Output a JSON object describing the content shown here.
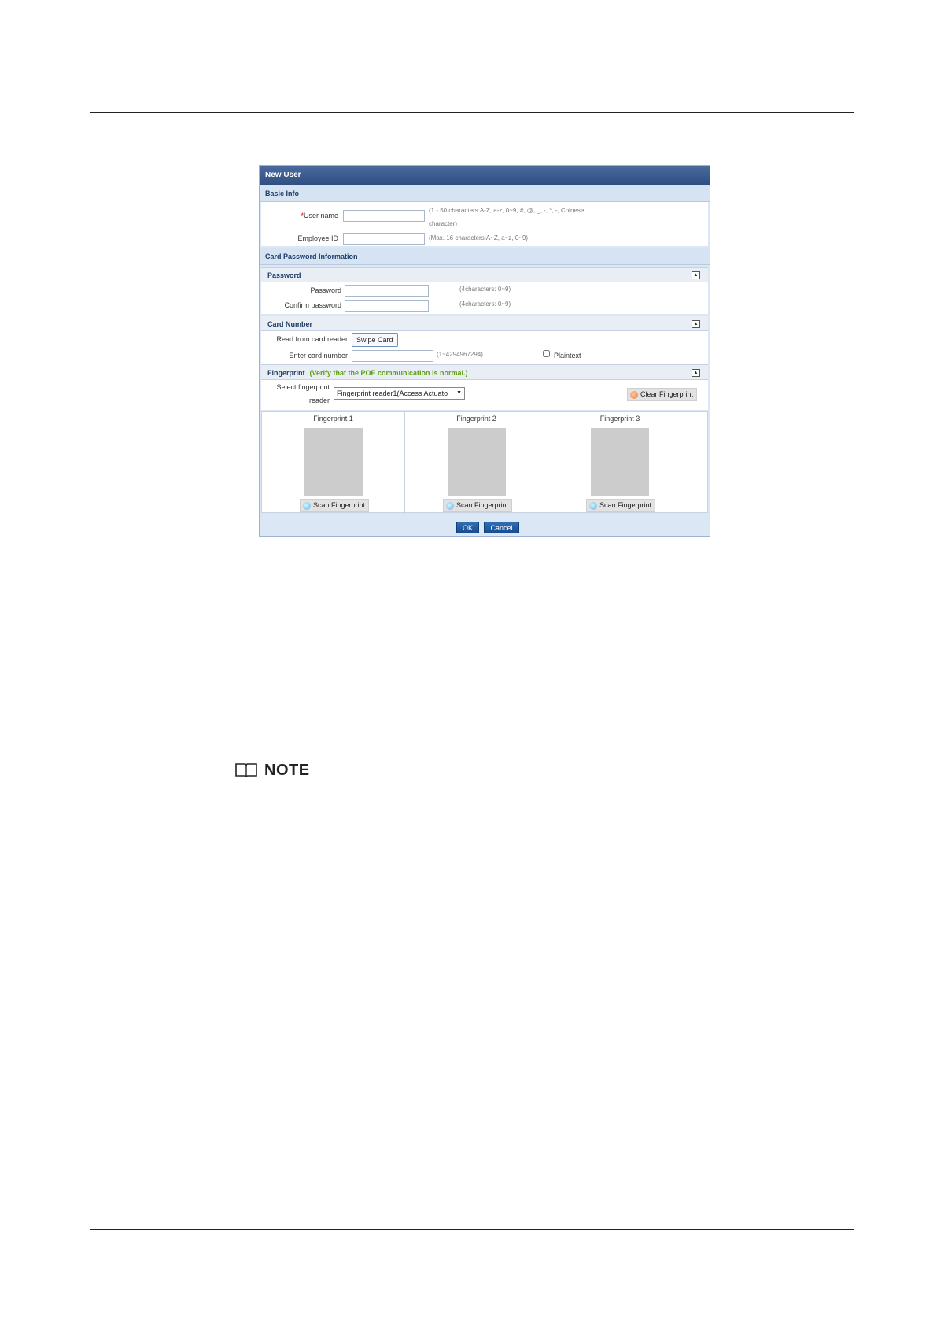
{
  "dialog": {
    "title": "New User",
    "basic_info": {
      "heading": "Basic Info",
      "user_name_required_mark": "*",
      "user_name_label": "User name",
      "user_name_hint_line1": "(1 - 50 characters:A-Z, a-z, 0~9, #, @, _, -, *, -, Chinese",
      "user_name_hint_line2": "character)",
      "user_name_value": "",
      "employee_id_label": "Employee ID",
      "employee_id_hint": "(Max. 16 characters:A~Z, a~z, 0~9)",
      "employee_id_value": ""
    },
    "card_password": {
      "heading": "Card Password Information",
      "password_section": {
        "heading": "Password",
        "password_label": "Password",
        "password_hint": "(4characters: 0~9)",
        "confirm_label": "Confirm password",
        "confirm_hint": "(4characters: 0~9)"
      },
      "card_section": {
        "heading": "Card Number",
        "read_label": "Read from card reader",
        "swipe_button": "Swipe Card",
        "enter_label": "Enter card number",
        "enter_hint": "(1~4294967294)",
        "plaintext_label": "Plaintext",
        "plaintext_checked": false
      },
      "fingerprint_section": {
        "heading": "Fingerprint",
        "warning": "(Verify that the POE communication is normal.)",
        "select_label_line1": "Select fingerprint",
        "select_label_line2": "reader",
        "selected_reader": "Fingerprint reader1(Access Actuato",
        "clear_button": "Clear Fingerprint",
        "slots": [
          {
            "title": "Fingerprint 1",
            "scan_button": "Scan Fingerprint"
          },
          {
            "title": "Fingerprint 2",
            "scan_button": "Scan Fingerprint"
          },
          {
            "title": "Fingerprint 3",
            "scan_button": "Scan Fingerprint"
          }
        ]
      }
    },
    "footer": {
      "ok_button": "OK",
      "cancel_button": "Cancel"
    }
  },
  "note": {
    "icon": "book-icon",
    "label": "NOTE"
  },
  "colors": {
    "title_bar": "#2f4f82",
    "section_bg": "#d6e3f3",
    "warning_text": "#5fa010",
    "primary_button": "#174e91"
  }
}
